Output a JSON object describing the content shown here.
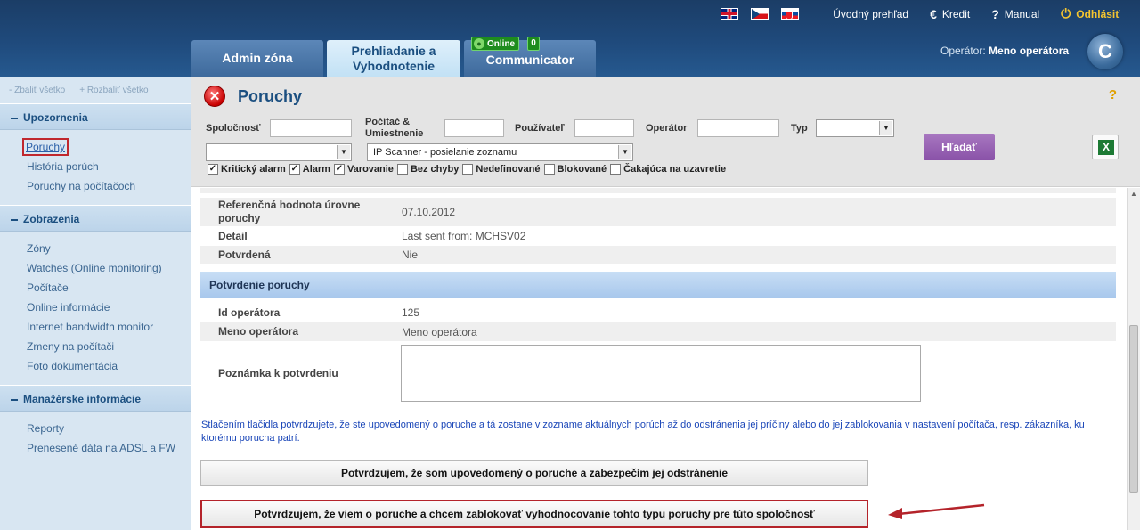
{
  "topbar": {
    "flags": [
      "en-flag",
      "cz-flag",
      "sk-flag"
    ],
    "links": [
      {
        "label": "Úvodný prehľad",
        "icon": ""
      },
      {
        "label": "Kredit",
        "icon": "€"
      },
      {
        "label": "Manual",
        "icon": "?"
      },
      {
        "label": "Odhlásiť",
        "icon": "⏻"
      }
    ]
  },
  "tabs": {
    "admin": "Admin zóna",
    "active": "Prehliadanie a Vyhodnotenie",
    "communicator": "Communicator",
    "online_label": "Online",
    "online_count": "0"
  },
  "operator": {
    "label": "Operátor:",
    "name": "Meno operátora"
  },
  "sidebar": {
    "collapse_all": "- Zbaliť všetko",
    "expand_all": "+ Rozbaliť všetko",
    "sections": [
      {
        "title": "Upozornenia",
        "items": [
          "Poruchy",
          "História porúch",
          "Poruchy na počítačoch"
        ]
      },
      {
        "title": "Zobrazenia",
        "items": [
          "Zóny",
          "Watches (Online monitoring)",
          "Počítače",
          "Online informácie",
          "Internet bandwidth monitor",
          "Zmeny na počítači",
          "Foto dokumentácia"
        ]
      },
      {
        "title": "Manažérske informácie",
        "items": [
          "Reporty",
          "Prenesené dáta na ADSL a FW"
        ]
      }
    ]
  },
  "page": {
    "title": "Poruchy",
    "help": "?"
  },
  "filter": {
    "company_label": "Spoločnosť",
    "computer_label": "Počítač & Umiestnenie",
    "user_label": "Používateľ",
    "operator_label": "Operátor",
    "type_label": "Typ",
    "company_select": "",
    "scanner_select": "IP Scanner - posielanie zoznamu",
    "search_button": "Hľadať",
    "export_icon": "excel-icon",
    "checkboxes": [
      {
        "label": "Kritický alarm",
        "checked": true
      },
      {
        "label": "Alarm",
        "checked": true
      },
      {
        "label": "Varovanie",
        "checked": true
      },
      {
        "label": "Bez chyby",
        "checked": false
      },
      {
        "label": "Nedefinované",
        "checked": false
      },
      {
        "label": "Blokované",
        "checked": false
      },
      {
        "label": "Čakajúca na uzavretie",
        "checked": false
      }
    ]
  },
  "detail": {
    "rows": [
      {
        "key": "Referenčná hodnota úrovne poruchy",
        "value": "07.10.2012"
      },
      {
        "key": "Detail",
        "value": "Last sent from: MCHSV02"
      },
      {
        "key": "Potvrdená",
        "value": "Nie"
      }
    ],
    "section_title": "Potvrdenie poruchy",
    "confirm_rows": [
      {
        "key": "Id operátora",
        "value": "125"
      },
      {
        "key": "Meno operátora",
        "value": "Meno operátora"
      }
    ],
    "note_label": "Poznámka k potvrdeniu",
    "info_text": "Stlačením tlačidla potvrdzujete, že ste upovedomený o poruche a tá zostane v zozname aktuálnych porúch až do odstránenia jej príčiny alebo do jej zablokovania v nastavení počítača, resp. zákazníka, ku ktorému porucha patrí.",
    "confirm_button": "Potvrdzujem, že som upovedomený o poruche a zabezpečím jej odstránenie",
    "block_button": "Potvrdzujem, že viem o poruche a chcem zablokovať vyhodnocovanie tohto typu poruchy pre túto spoločnosť"
  }
}
